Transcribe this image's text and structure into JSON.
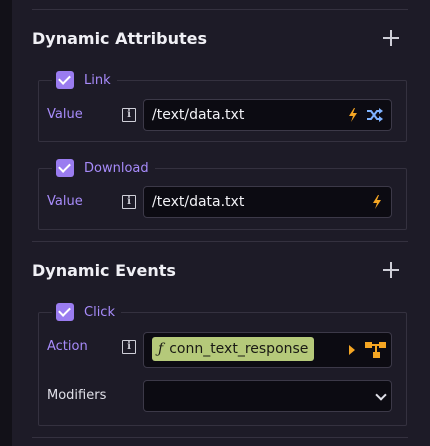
{
  "attributes": {
    "title": "Dynamic Attributes",
    "groups": [
      {
        "label": "Link",
        "row_label": "Value",
        "value": "/text/data.txt"
      },
      {
        "label": "Download",
        "row_label": "Value",
        "value": "/text/data.txt"
      }
    ]
  },
  "events": {
    "title": "Dynamic Events",
    "group": {
      "label": "Click",
      "action_label": "Action",
      "action_fn_symbol": "ƒ",
      "action_value": "conn_text_response",
      "modifiers_label": "Modifiers",
      "modifiers_value": ""
    }
  },
  "icons": {
    "add": "plus-icon",
    "info": "info-icon",
    "dynamic": "lightning-bolt-icon",
    "random": "shuffle-icon",
    "run": "caret-right-icon",
    "connection": "tree-structure-icon",
    "dropdown": "chevron-down-icon"
  },
  "colors": {
    "accent": "#a78bfa",
    "checkbox": "#9a7cf0",
    "bolt": "#f5a623",
    "chip": "#b5c97a",
    "panel": "#1d1b27"
  }
}
